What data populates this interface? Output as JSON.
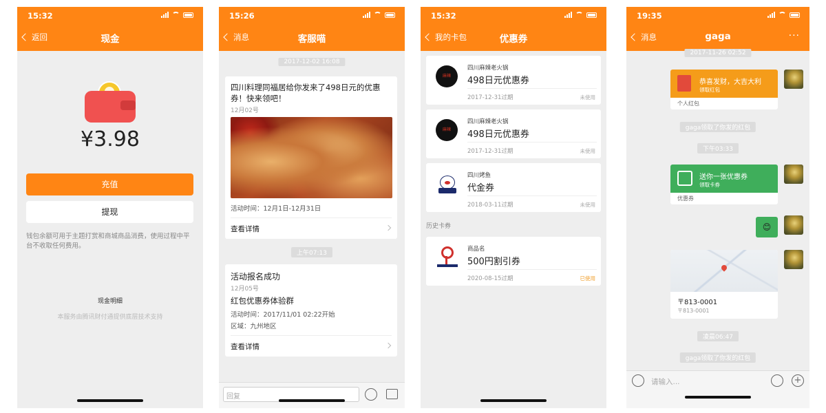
{
  "p1": {
    "time": "15:32",
    "back": "返回",
    "title": "现金",
    "amount": "¥3.98",
    "recharge": "充值",
    "withdraw": "提现",
    "note": "钱包余额可用于主题打赏和商城商品消费，使用过程中平台不收取任何费用。",
    "detail": "现金明细",
    "footer": "本服务由腾讯财付通提供底层技术支持"
  },
  "p2": {
    "time": "15:26",
    "back": "消息",
    "title": "客服喵",
    "ts1": "2017-12-02 16:08",
    "c1_title": "四川料理同福居给你发来了498日元的优惠券！快来领吧！",
    "c1_date": "12月02号",
    "c1_period": "活动时间：12月1日-12月31日",
    "c1_link": "查看详情",
    "ts2": "上午07:13",
    "c2_title": "活动报名成功",
    "c2_date": "12月05号",
    "c2_sub": "红包优惠券体验群",
    "c2_time": "活动时间：2017/11/01 02:22开始",
    "c2_area": "区域：九州地区",
    "c2_link": "查看详情",
    "input_placeholder": "回复"
  },
  "p3": {
    "time": "15:32",
    "back": "我的卡包",
    "title": "优惠券",
    "coupons": [
      {
        "shop": "四川麻辣老火锅",
        "name": "498日元优惠券",
        "expiry": "2017-12-31过期",
        "status": "未使用"
      },
      {
        "shop": "四川麻辣老火锅",
        "name": "498日元优惠券",
        "expiry": "2017-12-31过期",
        "status": "未使用"
      },
      {
        "shop": "四川烤鱼",
        "name": "代金券",
        "expiry": "2018-03-11过期",
        "status": "未使用"
      }
    ],
    "history_label": "历史卡券",
    "history": {
      "shop": "商品名",
      "name": "500円割引券",
      "expiry": "2020-08-15过期",
      "status": "已使用"
    },
    "logo_text": "麻辣"
  },
  "p4": {
    "time": "19:35",
    "back": "消息",
    "title": "gaga",
    "more": "···",
    "ts1": "2017-11-26 02:52",
    "rp_title": "恭喜发财，大吉大利",
    "rp_sub": "领取红包",
    "rp_footer": "个人红包",
    "notice1": "gaga领取了你发的红包",
    "ts2": "下午03:33",
    "cp_title": "送你一张优惠券",
    "cp_sub": "领取卡券",
    "cp_footer": "优惠券",
    "emoji": "😊",
    "loc_title": "〒813-0001",
    "loc_sub": "〒813-0001",
    "ts3": "凌晨06:47",
    "notice2": "gaga领取了你发的红包",
    "input_placeholder": "请输入..."
  },
  "colors": {
    "accent": "#ff8514",
    "green": "#3fae5b",
    "redpacket": "#f59c1a"
  }
}
